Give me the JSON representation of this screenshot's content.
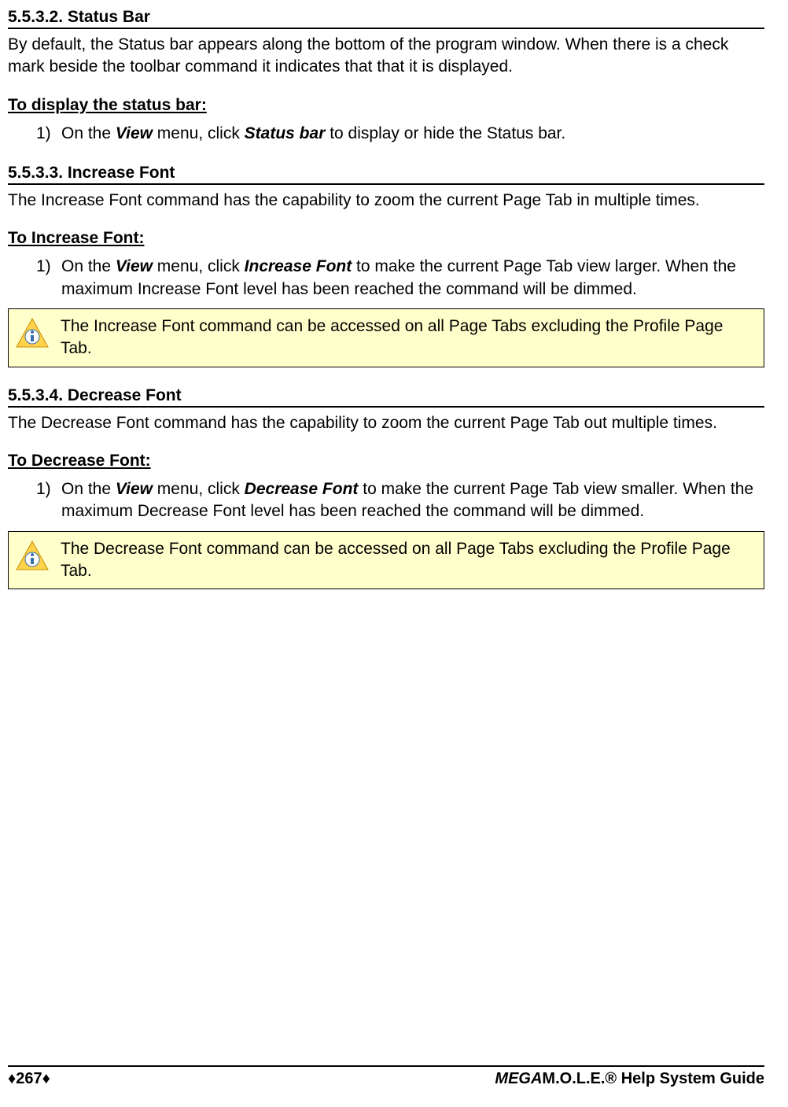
{
  "sections": [
    {
      "heading": "5.5.3.2. Status Bar",
      "intro": "By default, the Status bar appears along the bottom of the program window. When there is a check mark beside the toolbar command it indicates that that it is displayed.",
      "sub": "To display the status bar:",
      "step_num": "1)",
      "step_pre": "On the ",
      "step_b1": "View",
      "step_mid": " menu, click ",
      "step_b2": "Status bar",
      "step_post": " to display or hide the Status bar.",
      "note": null
    },
    {
      "heading": "5.5.3.3. Increase Font",
      "intro": "The Increase Font command has the capability to zoom the current Page Tab in multiple times.",
      "sub": "To Increase Font:",
      "step_num": "1)",
      "step_pre": "On the ",
      "step_b1": "View",
      "step_mid": " menu, click ",
      "step_b2": "Increase Font",
      "step_post": " to make the current Page Tab view larger.  When the maximum Increase Font level has been reached the command will be dimmed.",
      "note": "The Increase Font command can be accessed on all Page Tabs excluding the Profile Page Tab."
    },
    {
      "heading": "5.5.3.4. Decrease Font",
      "intro": "The Decrease Font command has the capability to zoom the current Page Tab out multiple times.",
      "sub": "To Decrease Font:",
      "step_num": "1)",
      "step_pre": "On the ",
      "step_b1": "View",
      "step_mid": " menu, click ",
      "step_b2": "Decrease Font",
      "step_post": " to make the current Page Tab view smaller.  When the maximum Decrease Font level has been reached the command will be dimmed.",
      "note": "The Decrease Font command can be accessed on all Page Tabs excluding the Profile Page Tab."
    }
  ],
  "footer": {
    "page": "♦267♦",
    "guide_prefix_italic": "MEGA",
    "guide_rest": "M.O.L.E.® Help System Guide"
  }
}
